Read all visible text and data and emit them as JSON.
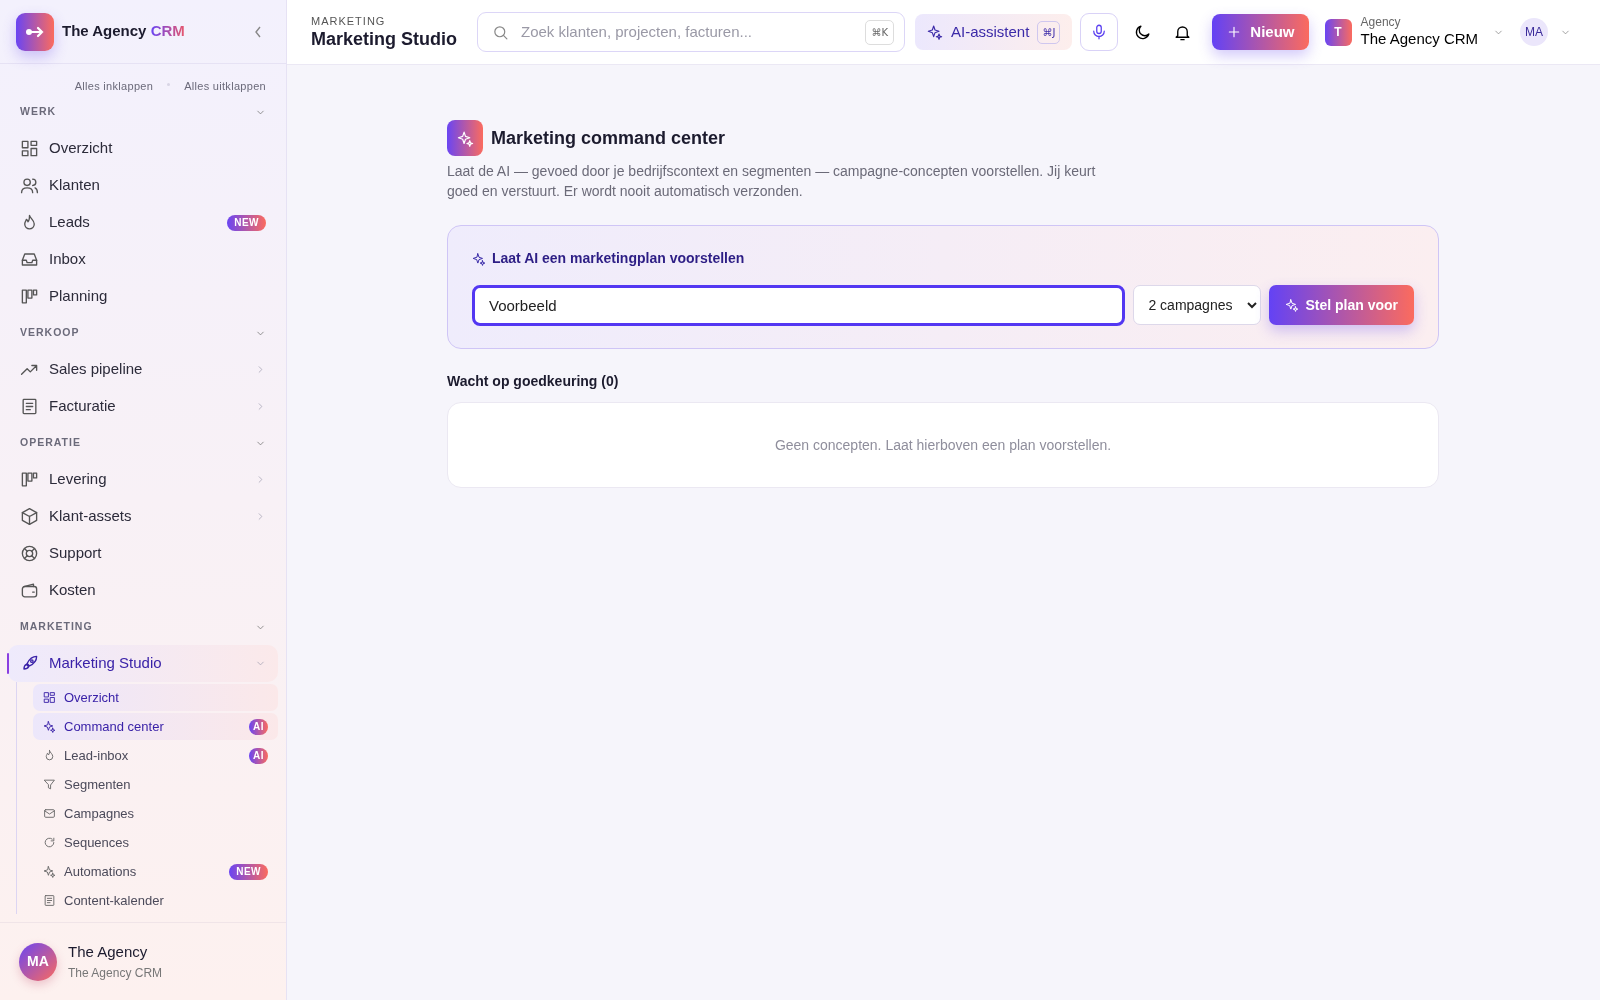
{
  "brand": {
    "name": "The Agency",
    "accent": "CRM"
  },
  "sidebar": {
    "collapse_all": "Alles inklappen",
    "expand_all": "Alles uitklappen",
    "sections": [
      {
        "title": "WERK",
        "expanded": true,
        "items": [
          {
            "label": "Overzicht",
            "selected": false
          },
          {
            "label": "Klanten",
            "selected": false
          },
          {
            "label": "Leads",
            "selected": false,
            "badge": "NEW"
          },
          {
            "label": "Inbox",
            "selected": false
          },
          {
            "label": "Planning",
            "selected": false
          }
        ]
      },
      {
        "title": "VERKOOP",
        "expanded": true,
        "items": [
          {
            "label": "Sales pipeline",
            "selected": false,
            "expanded": false
          },
          {
            "label": "Facturatie",
            "selected": false,
            "expanded": false
          }
        ]
      },
      {
        "title": "OPERATIE",
        "expanded": true,
        "items": [
          {
            "label": "Levering",
            "selected": false,
            "expanded": false
          },
          {
            "label": "Klant-assets",
            "selected": false,
            "expanded": false
          },
          {
            "label": "Support",
            "selected": false
          },
          {
            "label": "Kosten",
            "selected": false
          }
        ]
      },
      {
        "title": "MARKETING",
        "expanded": true,
        "items": [
          {
            "label": "Marketing Studio",
            "selected": true,
            "expanded": true,
            "children": [
              {
                "label": "Overzicht",
                "selected": true
              },
              {
                "label": "Command center",
                "selected": true,
                "badge": "AI"
              },
              {
                "label": "Lead-inbox",
                "selected": false,
                "badge": "AI"
              },
              {
                "label": "Segmenten",
                "selected": false
              },
              {
                "label": "Campagnes",
                "selected": false
              },
              {
                "label": "Sequences",
                "selected": false
              },
              {
                "label": "Automations",
                "selected": false,
                "badge": "NEW"
              },
              {
                "label": "Content-kalender",
                "selected": false
              }
            ]
          }
        ]
      }
    ]
  },
  "user": {
    "initials": "MA",
    "name": "The Agency",
    "org": "The Agency CRM"
  },
  "header": {
    "eyebrow": "MARKETING",
    "title": "Marketing Studio",
    "search": {
      "placeholder": "Zoek klanten, projecten, facturen...",
      "shortcut": "⌘K"
    },
    "ai_button": {
      "label": "AI-assistent",
      "shortcut": "⌘J"
    },
    "new_button": "Nieuw",
    "workspace": {
      "initial": "T",
      "label": "Agency",
      "name": "The Agency CRM"
    },
    "avatar": "MA"
  },
  "main": {
    "title": "Marketing command center",
    "description": "Laat de AI — gevoed door je bedrijfscontext en segmenten — campagne-concepten voorstellen. Jij keurt goed en verstuurt. Er wordt nooit automatisch verzonden.",
    "prompt_card": {
      "title": "Laat AI een marketingplan voorstellen",
      "input": {
        "value": "Voorbeeld"
      },
      "select": {
        "value": "2 campagnes"
      },
      "button": "Stel plan voor"
    },
    "queue_title": "Wacht op goedkeuring (0)",
    "empty_text": "Geen concepten. Laat hierboven een plan voorstellen."
  }
}
